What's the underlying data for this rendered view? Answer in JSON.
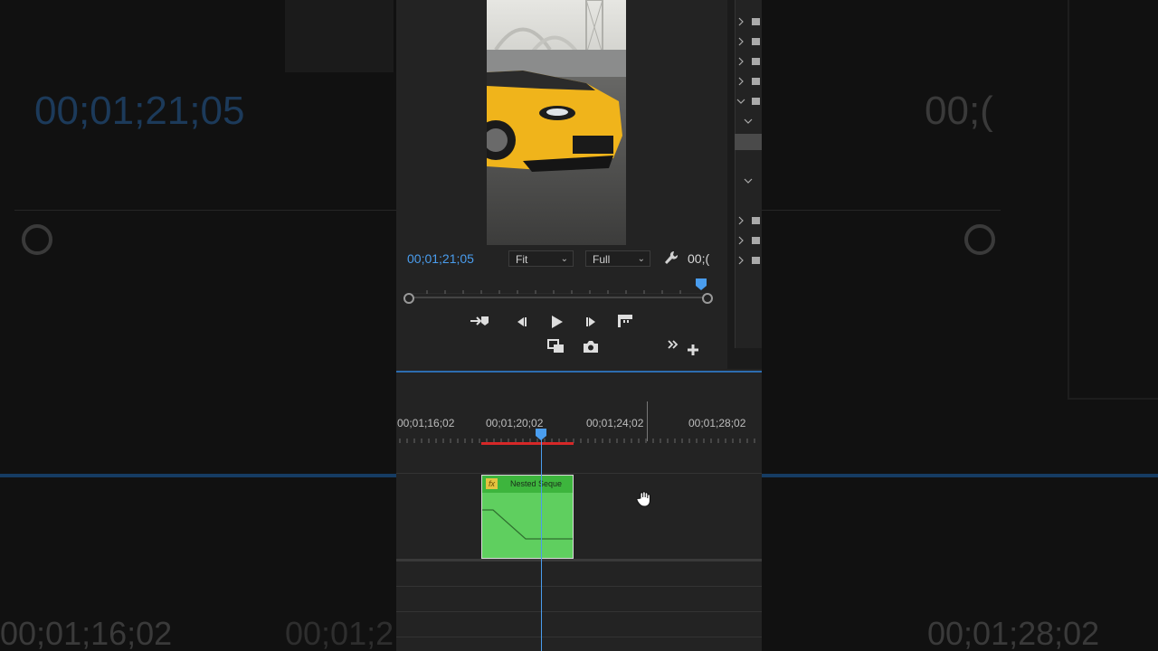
{
  "background": {
    "timecode": "00;01;21;05",
    "timecode_partial": "00;(",
    "timeline_label_left": "00;01;16;02",
    "timeline_label_mid": "00;01;2",
    "timeline_label_right": "00;01;28;02"
  },
  "program_monitor": {
    "timecode": "00;01;21;05",
    "zoom_label": "Fit",
    "resolution_label": "Full",
    "duration_partial": "00;("
  },
  "timeline": {
    "ruler_labels": [
      "00;01;16;02",
      "00;01;20;02",
      "00;01;24;02",
      "00;01;28;02"
    ],
    "clip": {
      "fx_badge": "fx",
      "name": "Nested Seque"
    }
  },
  "colors": {
    "accent": "#4a9dee",
    "clip_green": "#5fcf5f",
    "work_area_red": "#d62828"
  }
}
